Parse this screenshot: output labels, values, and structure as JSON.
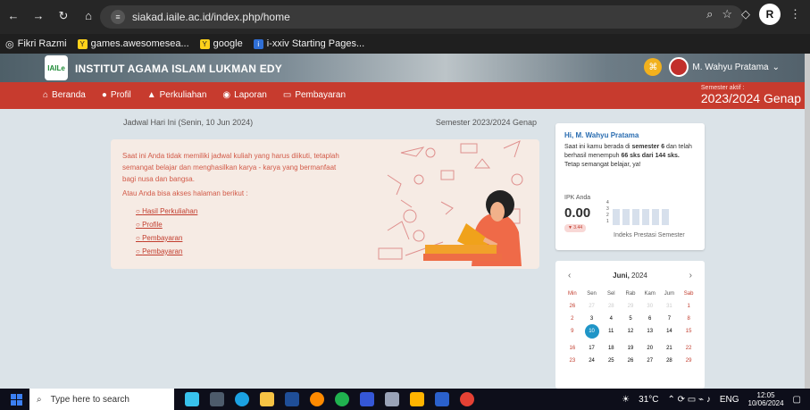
{
  "browser": {
    "url": "siakad.iaile.ac.id/index.php/home",
    "bookmarks": [
      "Fikri Razmi",
      "games.awesomesea...",
      "google",
      "i-xxiv Starting Pages..."
    ]
  },
  "site": {
    "institution": "INSTITUT AGAMA ISLAM LUKMAN EDY",
    "logo_text": "IAILe",
    "user": "M. Wahyu Pratama",
    "menu": [
      "Beranda",
      "Profil",
      "Perkuliahan",
      "Laporan",
      "Pembayaran"
    ],
    "semester_label": "Semester aktif :",
    "semester_value": "2023/2024 Genap"
  },
  "main": {
    "schedule_title": "Jadwal Hari Ini (Senin, 10 Jun 2024)",
    "schedule_semester": "Semester 2023/2024 Genap",
    "notice": "Saat ini Anda tidak memiliki jadwal kuliah yang harus diikuti, tetaplah semangat belajar dan menghasilkan karya - karya yang bermanfaat bagi nusa dan bangsa.",
    "access_text": "Atau Anda bisa akses halaman berikut :",
    "links": [
      "Hasil Perkuliahan",
      "Profile",
      "Pembayaran",
      "Pembayaran"
    ]
  },
  "profile_card": {
    "greeting": "Hi, M. Wahyu Pratama",
    "info_1": "Saat ini kamu berada di",
    "info_semester": "semester 6",
    "info_2": "dan telah berhasil menempuh",
    "info_sks": "66 sks dari 144 sks.",
    "info_3": "Tetap semangat belajar, ya!",
    "ipk_label": "IPK Anda",
    "ipk_value": "0.00",
    "ipk_change": "▼ 3.44",
    "chart_label": "Indeks Prestasi Semester",
    "ticks": [
      "4",
      "3",
      "2",
      "1"
    ]
  },
  "calendar": {
    "month": "Juni,",
    "year": "2024",
    "days": [
      "Min",
      "Sen",
      "Sel",
      "Rab",
      "Kam",
      "Jum",
      "Sab"
    ],
    "rows": [
      [
        "26",
        "27",
        "28",
        "29",
        "30",
        "31",
        "1"
      ],
      [
        "2",
        "3",
        "4",
        "5",
        "6",
        "7",
        "8"
      ],
      [
        "9",
        "10",
        "11",
        "12",
        "13",
        "14",
        "15"
      ],
      [
        "16",
        "17",
        "18",
        "19",
        "20",
        "21",
        "22"
      ],
      [
        "23",
        "24",
        "25",
        "26",
        "27",
        "28",
        "29"
      ]
    ]
  },
  "taskbar": {
    "search_placeholder": "Type here to search",
    "weather": "31°C",
    "lang": "ENG",
    "time": "12:05",
    "date": "10/06/2024"
  }
}
